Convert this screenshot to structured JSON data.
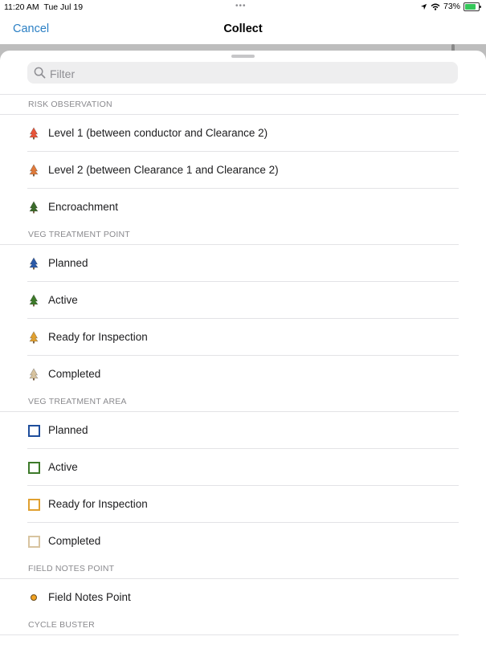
{
  "status_bar": {
    "time": "11:20 AM",
    "date": "Tue Jul 19",
    "more": "•••",
    "battery_percent": "73%"
  },
  "nav": {
    "cancel_label": "Cancel",
    "title": "Collect"
  },
  "search": {
    "placeholder": "Filter",
    "value": ""
  },
  "sections": [
    {
      "header": "RISK OBSERVATION",
      "items": [
        {
          "label": "Level 1 (between conductor and Clearance 2)",
          "icon": "tree-icon",
          "color": "#e8553a"
        },
        {
          "label": "Level 2 (between Clearance 1 and Clearance 2)",
          "icon": "tree-icon",
          "color": "#e07a3a"
        },
        {
          "label": "Encroachment",
          "icon": "tree-icon",
          "color": "#3b6b2a"
        }
      ]
    },
    {
      "header": "VEG TREATMENT POINT",
      "items": [
        {
          "label": "Planned",
          "icon": "tree-icon",
          "color": "#2c5aa8"
        },
        {
          "label": "Active",
          "icon": "tree-icon",
          "color": "#3d7a2a"
        },
        {
          "label": "Ready for Inspection",
          "icon": "tree-icon",
          "color": "#e0a030"
        },
        {
          "label": "Completed",
          "icon": "tree-icon",
          "color": "#d8c4a0"
        }
      ]
    },
    {
      "header": "VEG TREATMENT AREA",
      "items": [
        {
          "label": "Planned",
          "icon": "square-icon",
          "color": "#1f4e9c"
        },
        {
          "label": "Active",
          "icon": "square-icon",
          "color": "#3d7a2a"
        },
        {
          "label": "Ready for Inspection",
          "icon": "square-icon",
          "color": "#e0a030"
        },
        {
          "label": "Completed",
          "icon": "square-icon",
          "color": "#d8c4a0"
        }
      ]
    },
    {
      "header": "FIELD NOTES POINT",
      "items": [
        {
          "label": "Field Notes Point",
          "icon": "dot-icon",
          "color": "#f2a322"
        }
      ]
    },
    {
      "header": "CYCLE BUSTER",
      "items": []
    }
  ]
}
